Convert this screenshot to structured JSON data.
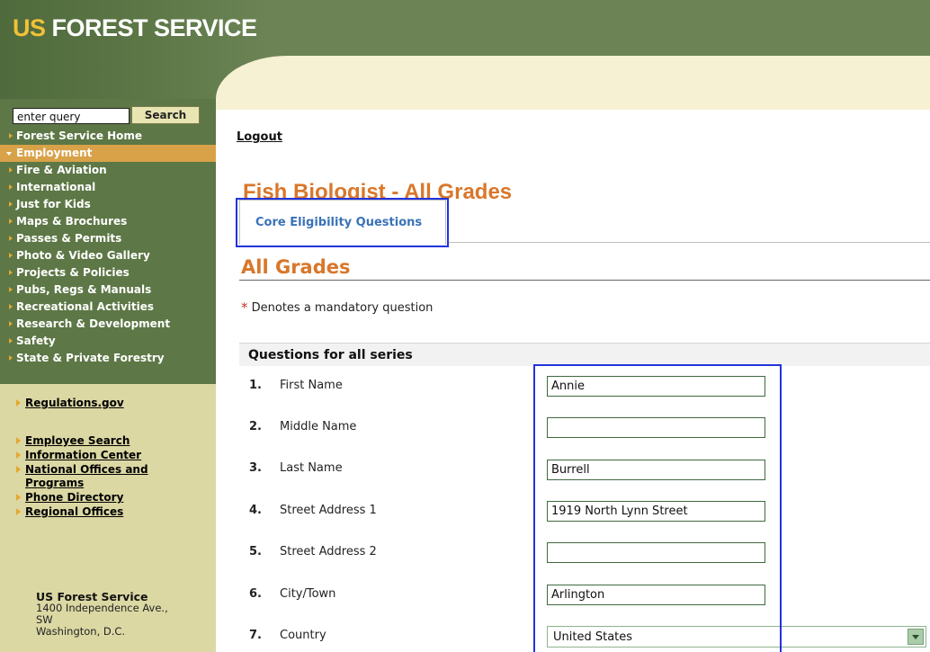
{
  "header": {
    "logo_us": "US",
    "logo_rest": " FOREST SERVICE"
  },
  "search": {
    "value": "enter query",
    "button_label": "Search"
  },
  "nav": {
    "items": [
      {
        "label": "Forest Service Home",
        "active": false
      },
      {
        "label": "Employment",
        "active": true
      },
      {
        "label": "Fire & Aviation",
        "active": false
      },
      {
        "label": "International",
        "active": false
      },
      {
        "label": "Just for Kids",
        "active": false
      },
      {
        "label": "Maps & Brochures",
        "active": false
      },
      {
        "label": "Passes & Permits",
        "active": false
      },
      {
        "label": "Photo & Video Gallery",
        "active": false
      },
      {
        "label": "Projects & Policies",
        "active": false
      },
      {
        "label": "Pubs, Regs & Manuals",
        "active": false
      },
      {
        "label": "Recreational Activities",
        "active": false
      },
      {
        "label": "Research & Development",
        "active": false
      },
      {
        "label": "Safety",
        "active": false
      },
      {
        "label": "State & Private Forestry",
        "active": false
      }
    ]
  },
  "sidebar_links": {
    "regulations": "Regulations.gov",
    "employee_search": "Employee Search",
    "information_center": "Information Center",
    "national_offices_1": "National Offices and",
    "national_offices_2": "Programs",
    "phone_directory": "Phone Directory",
    "regional_offices": "Regional Offices"
  },
  "address": {
    "org": "US Forest Service",
    "line1": "1400 Independence Ave.,",
    "line2": "SW",
    "line3": "Washington, D.C."
  },
  "main": {
    "logout": "Logout",
    "title": "Fish Biologist - All Grades",
    "tab_label": "Core Eligibility Questions",
    "section_title": "All Grades",
    "mandatory_star": "*",
    "mandatory_text": " Denotes a mandatory question",
    "questions_header": "Questions for all series"
  },
  "questions": [
    {
      "num": "1.",
      "label": "First Name",
      "value": "Annie"
    },
    {
      "num": "2.",
      "label": "Middle Name",
      "value": ""
    },
    {
      "num": "3.",
      "label": "Last Name",
      "value": "Burrell"
    },
    {
      "num": "4.",
      "label": "Street Address 1",
      "value": "1919 North Lynn Street"
    },
    {
      "num": "5.",
      "label": "Street Address 2",
      "value": ""
    },
    {
      "num": "6.",
      "label": "City/Town",
      "value": "Arlington"
    },
    {
      "num": "7.",
      "label": "Country",
      "value": "United States"
    }
  ],
  "colors": {
    "header_green": "#6c8455",
    "sidebar_green": "#5d7746",
    "sidebar_tan": "#dcd8a4",
    "active_nav": "#d9a248",
    "title_orange": "#d9772b",
    "tab_blue": "#3a72b8",
    "highlight_blue": "#2233dd"
  }
}
